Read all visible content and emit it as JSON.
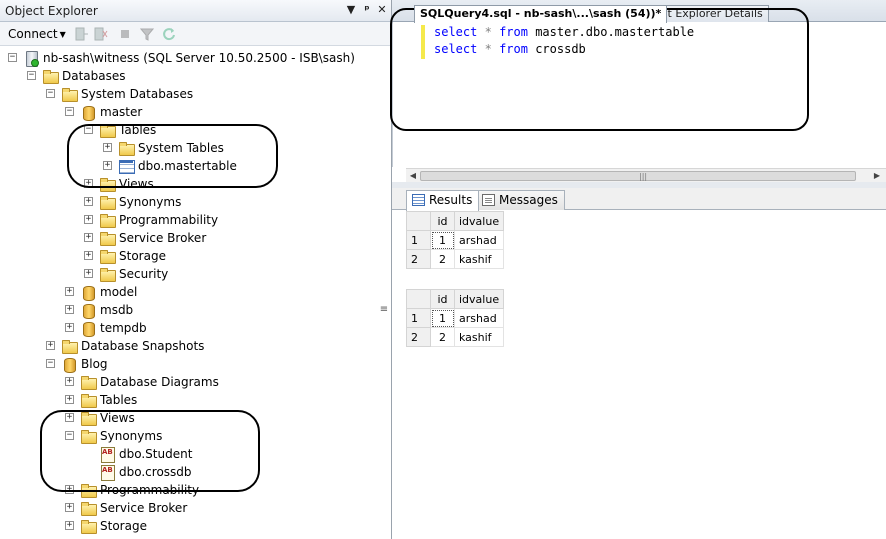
{
  "object_explorer": {
    "title": "Object Explorer",
    "pin_glyph": "▼",
    "pin2_glyph": "ᵖ",
    "close_glyph": "✕",
    "connect_label": "Connect",
    "tree": [
      {
        "label": "nb-sash\\witness (SQL Server 10.50.2500 - ISB\\sash)",
        "icon": "server-icon",
        "expander": "−"
      },
      {
        "label": "Databases",
        "icon": "folder-icon",
        "expander": "−"
      },
      {
        "label": "System Databases",
        "icon": "folder-icon",
        "expander": "−"
      },
      {
        "label": "master",
        "icon": "database-icon",
        "expander": "−"
      },
      {
        "label": "Tables",
        "icon": "folder-icon",
        "expander": "−"
      },
      {
        "label": "System Tables",
        "icon": "folder-icon",
        "expander": "+"
      },
      {
        "label": "dbo.mastertable",
        "icon": "table-icon",
        "expander": "+"
      },
      {
        "label": "Views",
        "icon": "folder-icon",
        "expander": "+"
      },
      {
        "label": "Synonyms",
        "icon": "folder-icon",
        "expander": "+"
      },
      {
        "label": "Programmability",
        "icon": "folder-icon",
        "expander": "+"
      },
      {
        "label": "Service Broker",
        "icon": "folder-icon",
        "expander": "+"
      },
      {
        "label": "Storage",
        "icon": "folder-icon",
        "expander": "+"
      },
      {
        "label": "Security",
        "icon": "folder-icon",
        "expander": "+"
      },
      {
        "label": "model",
        "icon": "database-icon",
        "expander": "+"
      },
      {
        "label": "msdb",
        "icon": "database-icon",
        "expander": "+"
      },
      {
        "label": "tempdb",
        "icon": "database-icon",
        "expander": "+"
      },
      {
        "label": "Database Snapshots",
        "icon": "folder-icon",
        "expander": "+"
      },
      {
        "label": "Blog",
        "icon": "database-icon",
        "expander": "−"
      },
      {
        "label": "Database Diagrams",
        "icon": "folder-icon",
        "expander": "+"
      },
      {
        "label": "Tables",
        "icon": "folder-icon",
        "expander": "+"
      },
      {
        "label": "Views",
        "icon": "folder-icon",
        "expander": "+"
      },
      {
        "label": "Synonyms",
        "icon": "folder-icon",
        "expander": "−"
      },
      {
        "label": "dbo.Student",
        "icon": "synonym-icon",
        "expander": ""
      },
      {
        "label": "dbo.crossdb",
        "icon": "synonym-icon",
        "expander": ""
      },
      {
        "label": "Programmability",
        "icon": "folder-icon",
        "expander": "+"
      },
      {
        "label": "Service Broker",
        "icon": "folder-icon",
        "expander": "+"
      },
      {
        "label": "Storage",
        "icon": "folder-icon",
        "expander": "+"
      }
    ]
  },
  "editor": {
    "tabs": [
      {
        "label": "SQLQuery4.sql - nb-sash\\...\\sash (54))*",
        "active": true
      },
      {
        "label": "Object Explorer Details",
        "active": false
      }
    ],
    "lines": [
      {
        "kw1": "select",
        "star": "*",
        "kw2": "from",
        "target": "master.dbo.mastertable"
      },
      {
        "kw1": "select",
        "star": "*",
        "kw2": "from",
        "target": "crossdb"
      }
    ]
  },
  "results": {
    "tabs": [
      {
        "label": "Results",
        "icon": "grid-icon"
      },
      {
        "label": "Messages",
        "icon": "messages-icon"
      }
    ],
    "grids": [
      {
        "columns": [
          "id",
          "idvalue"
        ],
        "rows": [
          [
            "1",
            "1",
            "arshad"
          ],
          [
            "2",
            "2",
            "kashif"
          ]
        ]
      },
      {
        "columns": [
          "id",
          "idvalue"
        ],
        "rows": [
          [
            "1",
            "1",
            "arshad"
          ],
          [
            "2",
            "2",
            "kashif"
          ]
        ]
      }
    ]
  },
  "colors": {
    "keyword": "#0000ff",
    "operator": "#808080",
    "annotation": "#000000"
  }
}
